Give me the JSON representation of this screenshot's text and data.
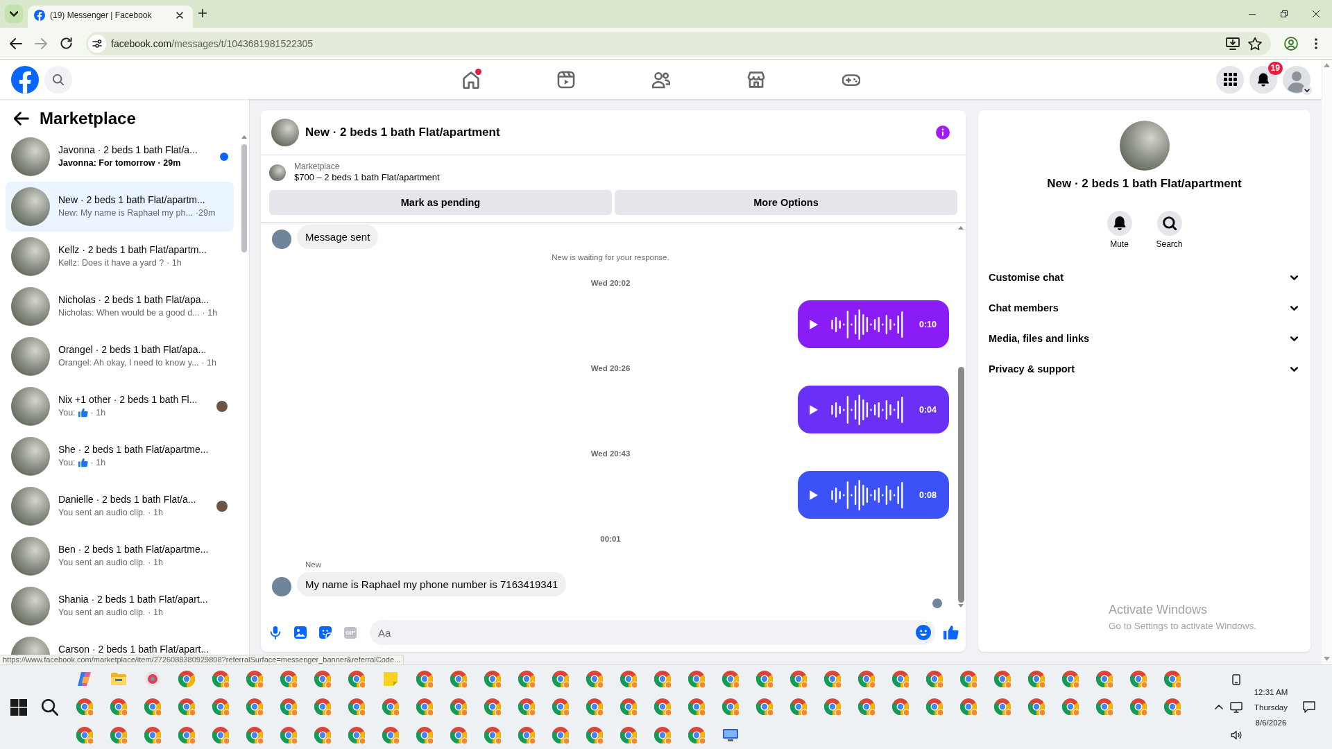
{
  "browser": {
    "tab": {
      "title": "(19) Messenger | Facebook",
      "selected": true
    },
    "url_host": "facebook.com",
    "url_path": "/messages/t/1043681981522305",
    "status_url": "https://www.facebook.com/marketplace/item/2726088380929808?referralSurface=messenger_banner&referralCode..."
  },
  "header": {
    "nav": [
      {
        "kind": "home",
        "selected": false,
        "dot": true
      },
      {
        "kind": "video",
        "selected": false,
        "dot": false
      },
      {
        "kind": "friends",
        "selected": false,
        "dot": false
      },
      {
        "kind": "store",
        "selected": false,
        "dot": false
      },
      {
        "kind": "gaming",
        "selected": false,
        "dot": false
      }
    ],
    "notification_count": "19"
  },
  "sidebar": {
    "title": "Marketplace",
    "conversations": [
      {
        "title": "Javonna · 2 beds 1 bath Flat/a...",
        "kind": "text",
        "preview": "Javonna: For tomorrow",
        "time": "· 29m",
        "unread": true,
        "seen": false,
        "selected": false
      },
      {
        "title": "New · 2 beds 1 bath Flat/apartm...",
        "kind": "text",
        "preview": "New: My name is Raphael my ph...",
        "time": "·29m",
        "unread": false,
        "seen": false,
        "selected": true
      },
      {
        "title": "Kellz · 2 beds 1 bath Flat/apartm...",
        "kind": "text",
        "preview": "Kellz: Does it have a yard ?",
        "time": "· 1h",
        "unread": false,
        "seen": false,
        "selected": false
      },
      {
        "title": "Nicholas · 2 beds 1 bath Flat/apa...",
        "kind": "text",
        "preview": "Nicholas: When would be a good d...",
        "time": "· 1h",
        "unread": false,
        "seen": false,
        "selected": false
      },
      {
        "title": "Orangel · 2 beds 1 bath Flat/apa...",
        "kind": "text",
        "preview": "Orangel: Ah okay, I need to know y...",
        "time": "· 1h",
        "unread": false,
        "seen": false,
        "selected": false
      },
      {
        "title": "Nix +1 other · 2 beds 1 bath Fl...",
        "kind": "like",
        "preview": "You:",
        "time": "· 1h",
        "unread": false,
        "seen": true,
        "selected": false
      },
      {
        "title": "She · 2 beds 1 bath Flat/apartme...",
        "kind": "like",
        "preview": "You:",
        "time": "· 1h",
        "unread": false,
        "seen": false,
        "selected": false
      },
      {
        "title": "Danielle · 2 beds 1 bath Flat/a...",
        "kind": "text",
        "preview": "You sent an audio clip.",
        "time": "· 1h",
        "unread": false,
        "seen": true,
        "selected": false
      },
      {
        "title": "Ben · 2 beds 1 bath Flat/apartme...",
        "kind": "text",
        "preview": "You sent an audio clip.",
        "time": "· 1h",
        "unread": false,
        "seen": false,
        "selected": false
      },
      {
        "title": "Shania · 2 beds 1 bath Flat/apart...",
        "kind": "text",
        "preview": "You sent an audio clip.",
        "time": "· 1h",
        "unread": false,
        "seen": false,
        "selected": false
      },
      {
        "title": "Carson · 2 beds 1 bath Flat/apart...",
        "unread": false,
        "seen": false,
        "selected": false
      }
    ]
  },
  "chat": {
    "title": "New · 2 beds 1 bath Flat/apartment",
    "listing": {
      "source": "Marketplace",
      "title": "$700 – 2 beds 1 bath Flat/apartment"
    },
    "actions": [
      "Mark as pending",
      "More Options"
    ],
    "messages": [
      {
        "kind": "incoming",
        "text": "Message sent"
      },
      {
        "kind": "notice",
        "text": "New is waiting for your response."
      },
      {
        "kind": "timestamp",
        "text": "Wed 20:02"
      },
      {
        "kind": "audio",
        "duration": "0:10",
        "color": "#8a1cf5"
      },
      {
        "kind": "timestamp",
        "text": "Wed 20:26"
      },
      {
        "kind": "audio",
        "duration": "0:04",
        "color": "#6a30f6"
      },
      {
        "kind": "timestamp",
        "text": "Wed 20:43"
      },
      {
        "kind": "audio",
        "duration": "0:08",
        "color": "#3d52f6"
      },
      {
        "kind": "timestamp",
        "text": "00:01"
      },
      {
        "kind": "sender",
        "text": "New"
      },
      {
        "kind": "incoming",
        "text": "My name is Raphael my phone number is 7163419341"
      },
      {
        "kind": "seen"
      }
    ],
    "composer": {
      "gif": "GIF",
      "placeholder": "Aa"
    }
  },
  "details": {
    "title": "New · 2 beds 1 bath Flat/apartment",
    "actions": [
      {
        "kind": "mute",
        "label": "Mute"
      },
      {
        "kind": "search",
        "label": "Search"
      }
    ],
    "sections": [
      {
        "label": "Customise chat",
        "expanded": false
      },
      {
        "label": "Chat members",
        "expanded": false
      },
      {
        "label": "Media, files and links",
        "expanded": false
      },
      {
        "label": "Privacy & support",
        "expanded": false
      }
    ]
  },
  "system": {
    "activation": {
      "title": "Activate Windows",
      "subtitle": "Go to Settings to activate Windows."
    },
    "clock": {
      "time": "12:31 AM",
      "day": "Thursday",
      "date": "8/6/2026"
    }
  }
}
